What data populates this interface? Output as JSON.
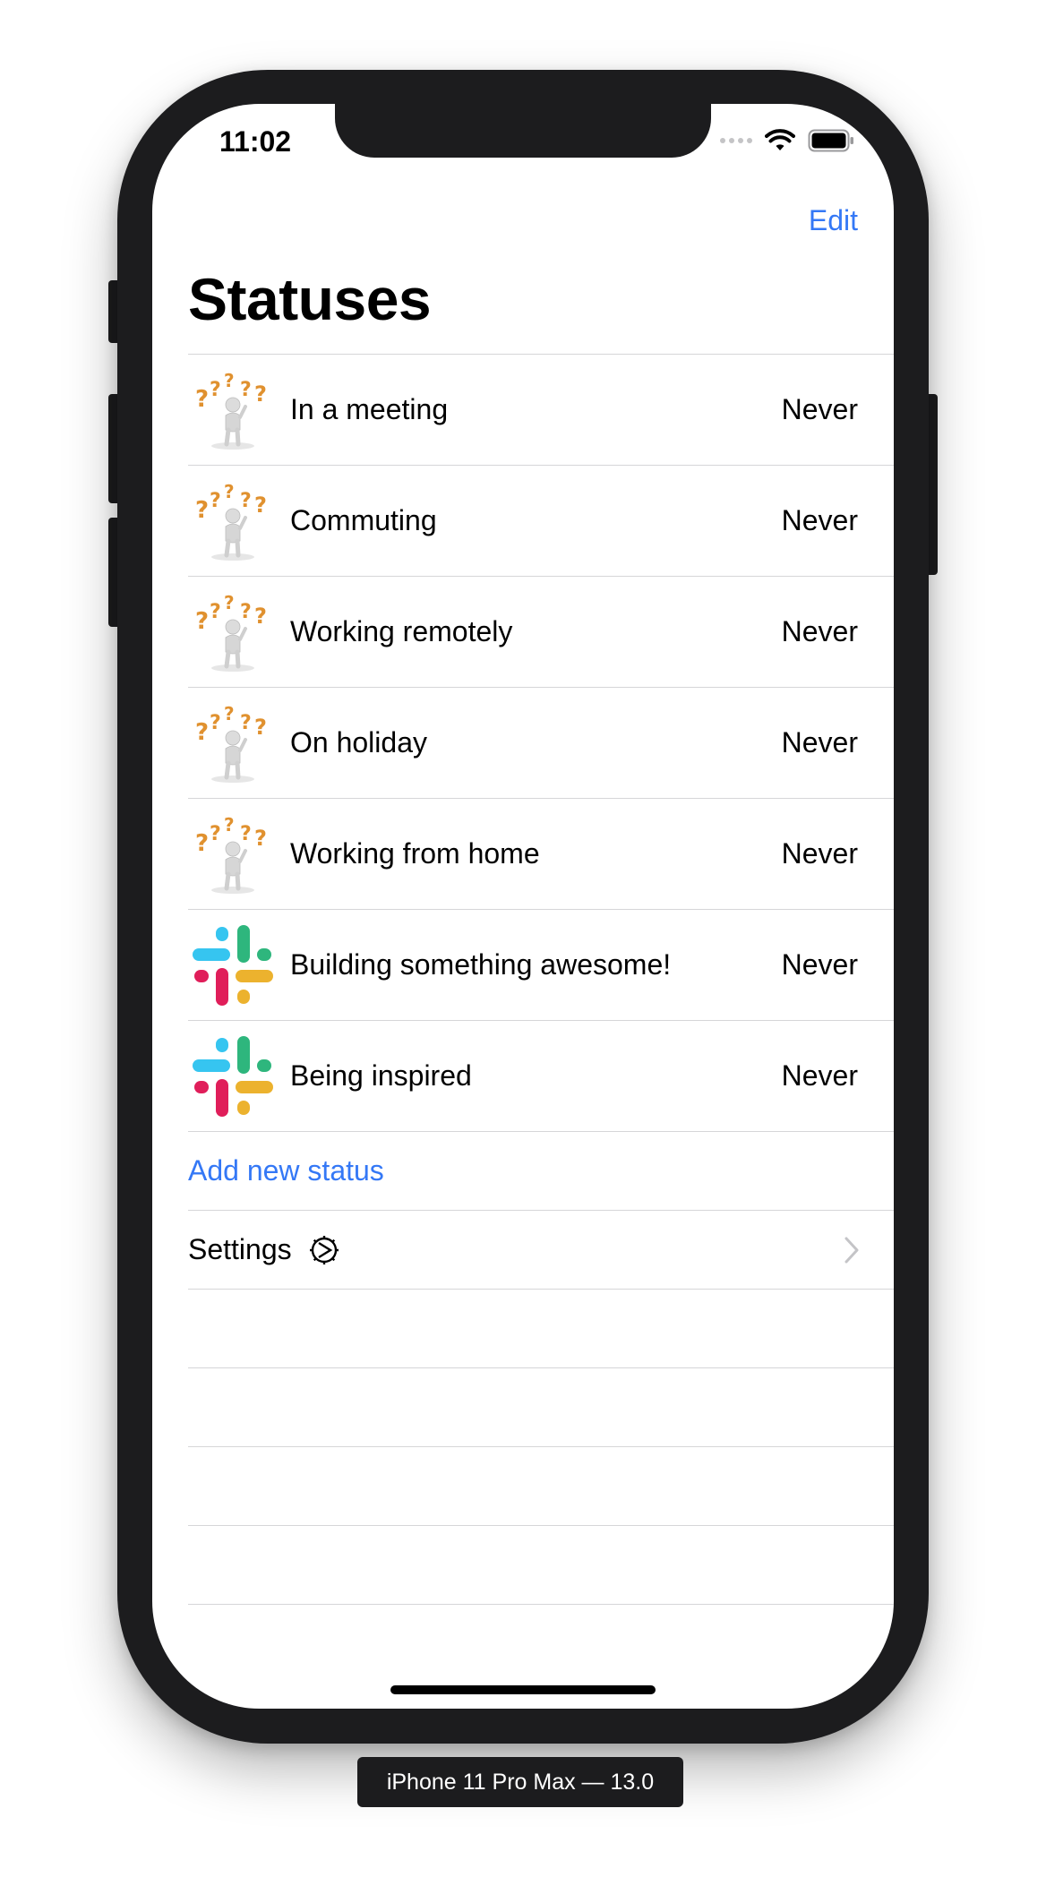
{
  "status_bar": {
    "time": "11:02"
  },
  "nav": {
    "edit_label": "Edit",
    "title": "Statuses"
  },
  "statuses": [
    {
      "icon": "thinking-figure-icon",
      "label": "In a meeting",
      "value": "Never"
    },
    {
      "icon": "thinking-figure-icon",
      "label": "Commuting",
      "value": "Never"
    },
    {
      "icon": "thinking-figure-icon",
      "label": "Working remotely",
      "value": "Never"
    },
    {
      "icon": "thinking-figure-icon",
      "label": "On holiday",
      "value": "Never"
    },
    {
      "icon": "thinking-figure-icon",
      "label": "Working from home",
      "value": "Never"
    },
    {
      "icon": "slack-logo-icon",
      "label": "Building something awesome!",
      "value": "Never"
    },
    {
      "icon": "slack-logo-icon",
      "label": "Being inspired",
      "value": "Never"
    }
  ],
  "actions": {
    "add_status": "Add new status",
    "settings": "Settings"
  },
  "device_label": "iPhone 11 Pro Max — 13.0",
  "colors": {
    "accent": "#3478f6",
    "frame": "#1c1c1e",
    "separator": "#d6d6d8",
    "slack_blue": "#36c5f0",
    "slack_green": "#2eb67d",
    "slack_red": "#e01e5a",
    "slack_yellow": "#ecb22e",
    "question_mark": "#e0912f"
  }
}
